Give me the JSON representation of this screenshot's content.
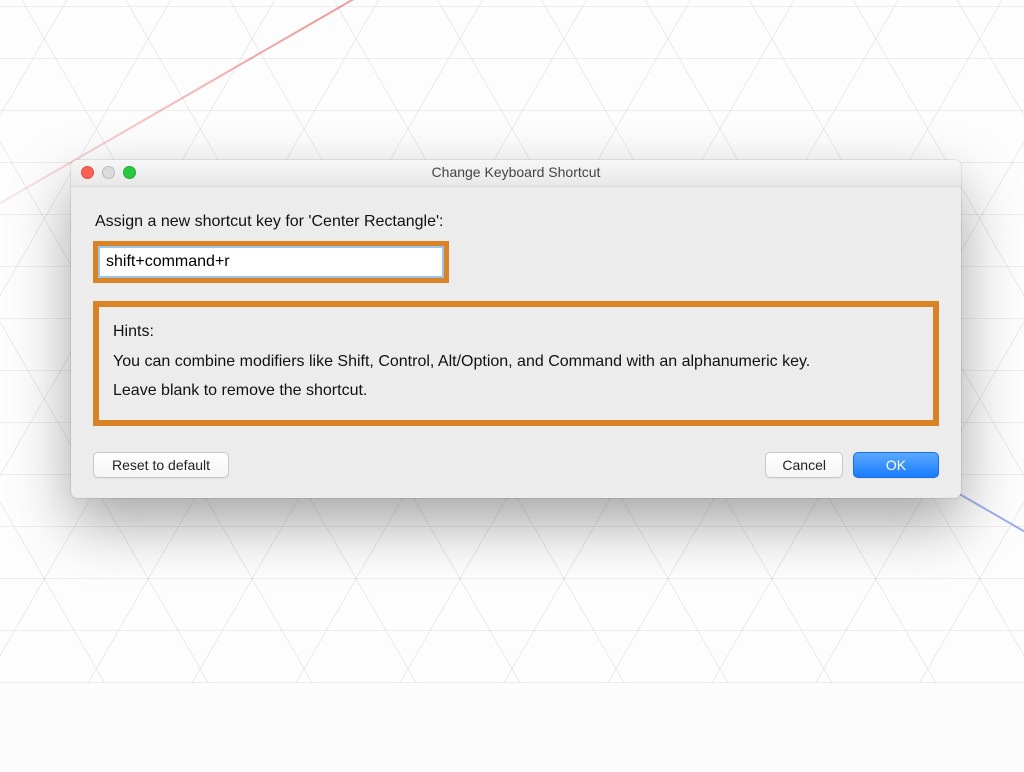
{
  "window": {
    "title": "Change Keyboard Shortcut"
  },
  "dialog": {
    "prompt": "Assign a new shortcut key for 'Center Rectangle':",
    "shortcut_value": "shift+command+r",
    "hints_title": "Hints:",
    "hints_line1": "You can combine modifiers like Shift, Control, Alt/Option, and Command with an alphanumeric key.",
    "hints_line2": "Leave blank to remove the shortcut."
  },
  "buttons": {
    "reset": "Reset to default",
    "cancel": "Cancel",
    "ok": "OK"
  },
  "colors": {
    "highlight": "#d98324",
    "primary_button": "#1a7cff"
  }
}
